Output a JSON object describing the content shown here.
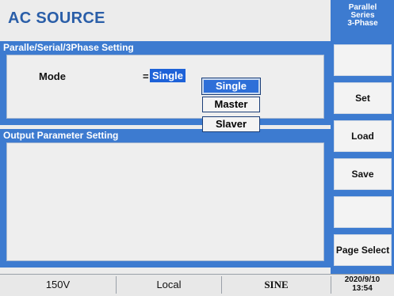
{
  "app": {
    "title": "AC SOURCE"
  },
  "sections": {
    "parallel": "Paralle/Serial/3Phase  Setting",
    "output": "Output  Parameter  Setting"
  },
  "mode": {
    "label": "Mode",
    "equals": "=",
    "value": "Single"
  },
  "dropdown": {
    "options": [
      "Single",
      "Master",
      "Slaver"
    ],
    "selected": "Single"
  },
  "sidebar": {
    "header": [
      "Parallel",
      "Series",
      "3-Phase"
    ],
    "buttons": [
      "",
      "Set",
      "Load",
      "Save",
      "",
      "Page Select"
    ]
  },
  "status": {
    "voltage": "150V",
    "control": "Local",
    "waveform": "SINE",
    "date": "2020/9/10",
    "time": "13:54"
  },
  "colors": {
    "accent": "#3d7bd0",
    "title": "#2a5ea8",
    "highlight": "#1e62d8"
  }
}
